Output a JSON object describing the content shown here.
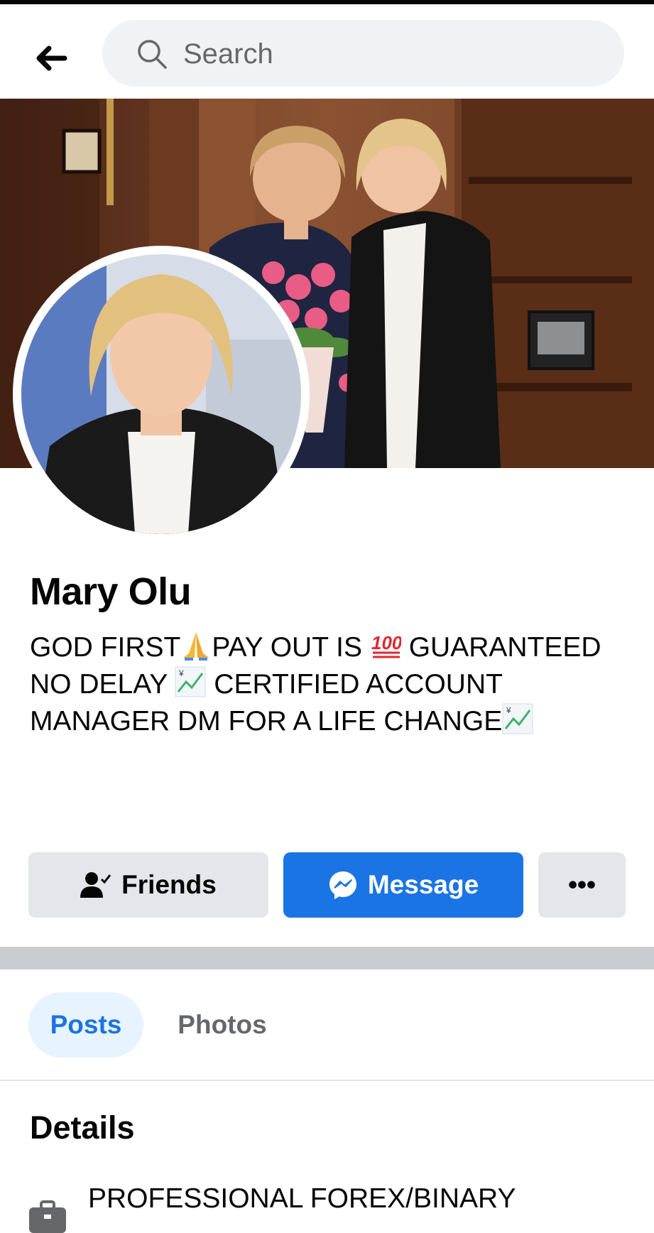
{
  "header": {
    "back_icon": "arrow-left-icon",
    "search_icon": "search-icon",
    "search_placeholder": "Search"
  },
  "profile": {
    "name": "Mary Olu",
    "bio_segments": [
      "GOD FIRST",
      "PAY OUT IS ",
      " GUARANTEED NO DELAY ",
      " CERTIFIED ACCOUNT MANAGER DM FOR A LIFE CHANGE"
    ],
    "bio_emojis": [
      "folded-hands-icon",
      "hundred-points-icon",
      "chart-increasing-yen-icon",
      "chart-increasing-yen-icon"
    ]
  },
  "actions": {
    "friends_label": "Friends",
    "message_label": "Message",
    "more_label": "•••"
  },
  "tabs": [
    {
      "label": "Posts",
      "active": true
    },
    {
      "label": "Photos",
      "active": false
    }
  ],
  "details": {
    "title": "Details",
    "items": [
      {
        "icon": "briefcase-icon",
        "text": "PROFESSIONAL FOREX/BINARY"
      }
    ]
  },
  "colors": {
    "accent": "#1b74e4",
    "accent_light": "#e7f3ff",
    "button_gray": "#e4e6eb",
    "search_bg": "#f0f2f5",
    "secondary_text": "#65676b"
  }
}
